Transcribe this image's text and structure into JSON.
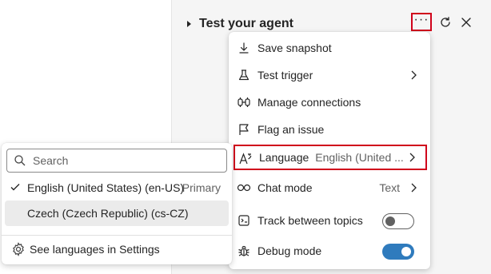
{
  "header": {
    "title": "Test your agent",
    "more_label": "···"
  },
  "menu": {
    "items": [
      {
        "label": "Save snapshot",
        "icon": "arrow-download-icon"
      },
      {
        "label": "Test trigger",
        "icon": "beaker-icon"
      },
      {
        "label": "Manage connections",
        "icon": "plug-connected-icon"
      },
      {
        "label": "Flag an issue",
        "icon": "flag-icon"
      },
      {
        "label": "Language",
        "value": "English (United ...",
        "icon": "text-language-icon"
      },
      {
        "label": "Chat mode",
        "value": "Text",
        "icon": "chat-mode-icon"
      },
      {
        "label": "Track between topics",
        "icon": "track-topics-icon",
        "toggle": false
      },
      {
        "label": "Debug mode",
        "icon": "bug-icon",
        "toggle": true
      }
    ]
  },
  "language_submenu": {
    "search_placeholder": "Search",
    "options": [
      {
        "label": "English (United States) (en-US)",
        "tag": "Primary",
        "selected": true
      },
      {
        "label": "Czech (Czech Republic) (cs-CZ)",
        "selected": false
      }
    ],
    "settings_link": "See languages in Settings"
  },
  "colors": {
    "accent": "#2f7bbd",
    "highlight_border": "#d0021b"
  }
}
